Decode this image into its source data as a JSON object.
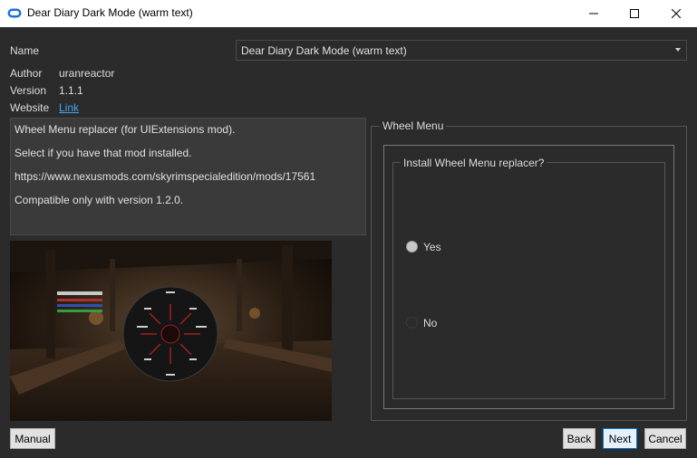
{
  "window": {
    "title": "Dear Diary Dark Mode (warm text)",
    "icon": "app-logo-icon"
  },
  "info": {
    "name_label": "Name",
    "name_value": "Dear Diary Dark Mode (warm text)",
    "author_label": "Author",
    "author_value": "uranreactor",
    "version_label": "Version",
    "version_value": "1.1.1",
    "website_label": "Website",
    "website_link": "Link"
  },
  "description": {
    "lines": [
      "Wheel Menu replacer (for UIExtensions mod).",
      "Select if you have that mod installed.",
      "https://www.nexusmods.com/skyrimspecialedition/mods/17561",
      "Compatible only with version 1.2.0."
    ]
  },
  "group": {
    "title": "Wheel Menu",
    "question": "Install Wheel Menu replacer?",
    "options": [
      {
        "label": "Yes",
        "selected": true
      },
      {
        "label": "No",
        "selected": false
      }
    ]
  },
  "buttons": {
    "manual": "Manual",
    "back": "Back",
    "next": "Next",
    "cancel": "Cancel"
  },
  "colors": {
    "background": "#2b2b2b",
    "link": "#3fa9f5",
    "accent": "#0078d7"
  }
}
